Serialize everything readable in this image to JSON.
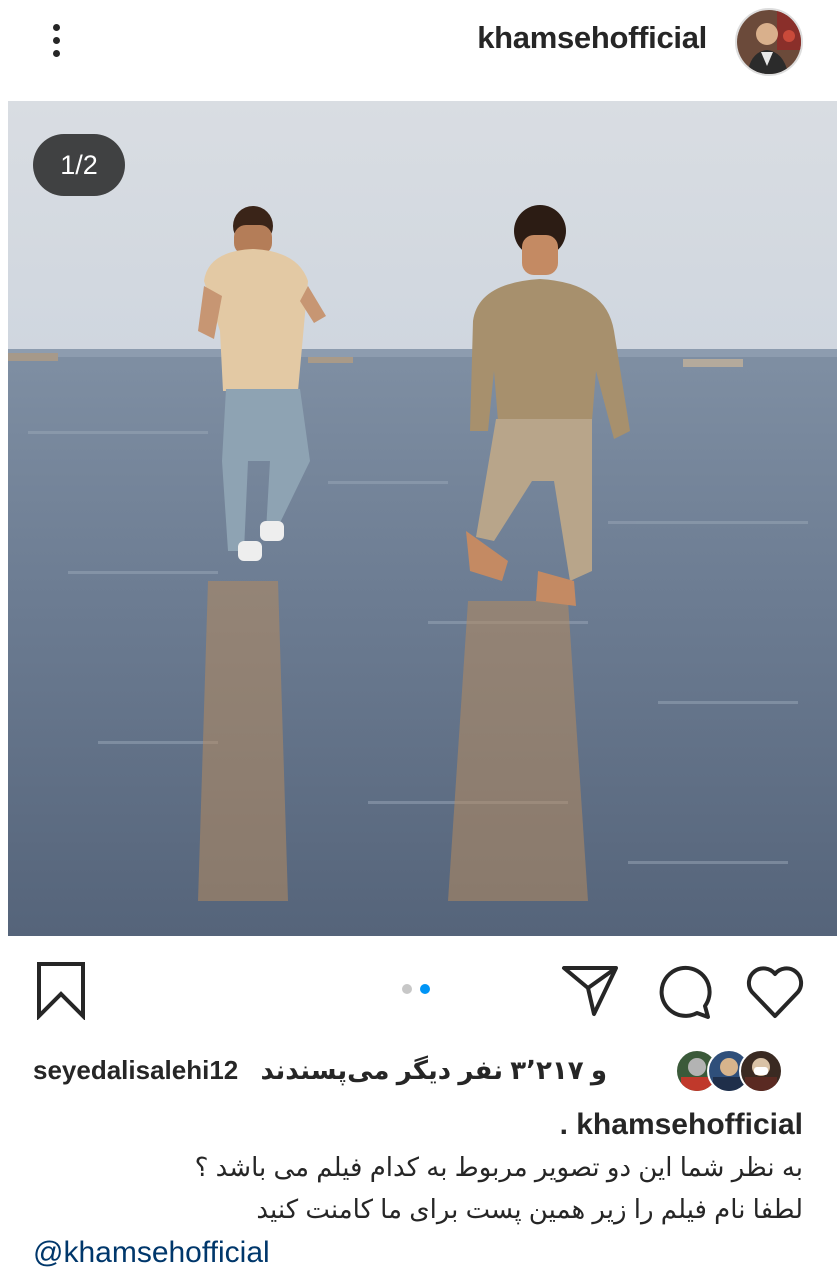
{
  "post": {
    "username": "khamsehofficial",
    "image_counter": "1/2",
    "likes_text": "و ۳٬۲۱۷ نفر دیگر می‌پسندند",
    "liked_by": "seyedalisalehi12",
    "caption_username": "khamsehofficial .",
    "caption_lines": [
      "به نظر شما این دو تصویر مربوط به کدام فیلم می باشد ؟",
      "لطفا نام فیلم را زیر همین پست برای ما کامنت کنید"
    ],
    "mention": "@khamsehofficial",
    "carousel": {
      "count": 2,
      "active_index": 1
    }
  },
  "colors": {
    "text": "#262626",
    "link": "#00376b",
    "carousel_active": "#0095f6",
    "carousel_inactive": "#c7c7c7"
  },
  "icons": {
    "more": "more-vertical-icon",
    "bookmark": "bookmark-icon",
    "share": "send-icon",
    "comment": "comment-icon",
    "like": "heart-icon"
  }
}
